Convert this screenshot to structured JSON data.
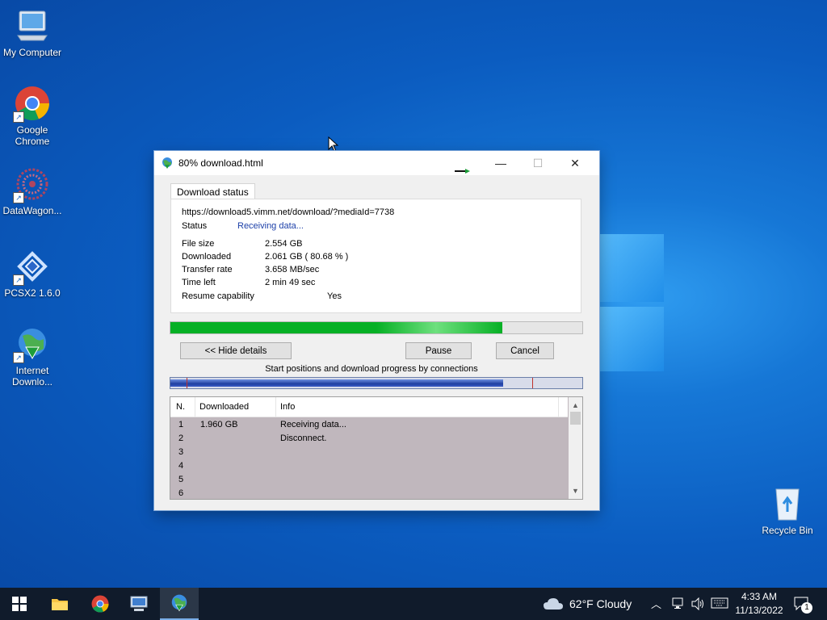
{
  "desktop": {
    "icons": [
      {
        "label": "My Computer"
      },
      {
        "label": "Google Chrome"
      },
      {
        "label": "DataWagon..."
      },
      {
        "label": "PCSX2 1.6.0"
      },
      {
        "label": "Internet Downlo..."
      },
      {
        "label": "Recycle Bin"
      }
    ]
  },
  "window": {
    "title": "80% download.html",
    "tab": "Download status",
    "url": "https://download5.vimm.net/download/?mediaId=7738",
    "status_label": "Status",
    "status_value": "Receiving data...",
    "fields": [
      {
        "label": "File size",
        "value": "2.554  GB"
      },
      {
        "label": "Downloaded",
        "value": "2.061  GB  ( 80.68 % )"
      },
      {
        "label": "Transfer rate",
        "value": "3.658  MB/sec"
      },
      {
        "label": "Time left",
        "value": "2 min 49 sec"
      },
      {
        "label": "Resume capability",
        "value": "Yes"
      }
    ],
    "progress_fraction": 0.8068,
    "buttons": {
      "hide_details": "<< Hide details",
      "pause": "Pause",
      "cancel": "Cancel"
    },
    "connections_caption": "Start positions and download progress by connections",
    "connections_progress_fraction": 0.807,
    "table": {
      "columns": [
        "N.",
        "Downloaded",
        "Info"
      ],
      "rows": [
        {
          "n": "1",
          "downloaded": "1.960  GB",
          "info": "Receiving data..."
        },
        {
          "n": "2",
          "downloaded": "",
          "info": "Disconnect."
        },
        {
          "n": "3",
          "downloaded": "",
          "info": ""
        },
        {
          "n": "4",
          "downloaded": "",
          "info": ""
        },
        {
          "n": "5",
          "downloaded": "",
          "info": ""
        },
        {
          "n": "6",
          "downloaded": "",
          "info": ""
        }
      ]
    }
  },
  "taskbar": {
    "weather": "62°F  Cloudy",
    "time": "4:33 AM",
    "date": "11/13/2022",
    "notification_count": "1"
  },
  "colors": {
    "progress_green": "#06b025",
    "status_blue": "#1b3fa8",
    "taskbar_bg": "#101b2b"
  }
}
